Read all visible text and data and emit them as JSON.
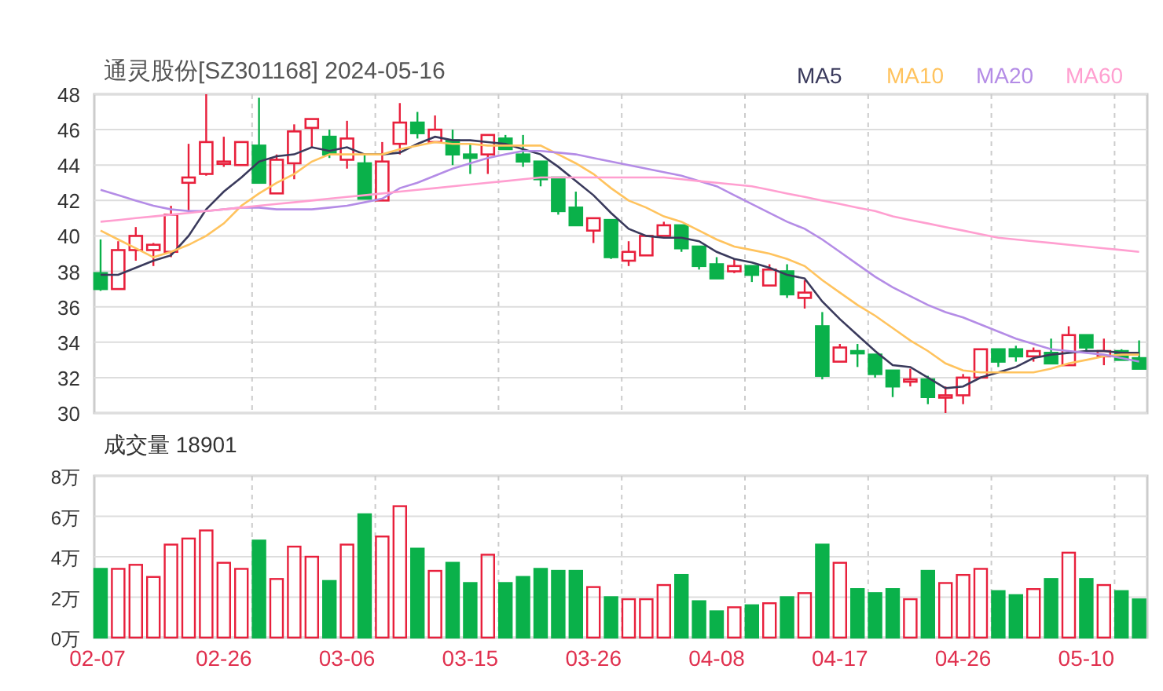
{
  "price_chart": {
    "chart_data": {
      "type": "candlestick",
      "title": "通灵股份[SZ301168] 2024-05-16",
      "ylim": [
        30,
        48
      ],
      "yticks": [
        30,
        32,
        34,
        36,
        38,
        40,
        42,
        44,
        46,
        48
      ],
      "grid": true,
      "categories": [
        null,
        null,
        null,
        null,
        null,
        null,
        null,
        null,
        null,
        null,
        null,
        null,
        null,
        null,
        null,
        null,
        null,
        null,
        null,
        null,
        null,
        null,
        null,
        null,
        null,
        null,
        null,
        null,
        null,
        null,
        null,
        null,
        null,
        null,
        null,
        null,
        null,
        null,
        null,
        null,
        null,
        null,
        null,
        null,
        null,
        null,
        null,
        null,
        null,
        null,
        null,
        null,
        null,
        null,
        null,
        null,
        null,
        null,
        null,
        null
      ],
      "ohlc": [
        [
          37.9,
          39.8,
          36.9,
          37.0
        ],
        [
          37.0,
          39.7,
          37.0,
          39.2
        ],
        [
          39.2,
          40.5,
          38.6,
          40.0
        ],
        [
          39.2,
          39.6,
          38.3,
          39.5
        ],
        [
          39.1,
          41.7,
          38.8,
          41.2
        ],
        [
          43.0,
          45.2,
          41.4,
          43.3
        ],
        [
          43.5,
          48.0,
          43.4,
          45.3
        ],
        [
          44.1,
          45.6,
          43.9,
          44.2
        ],
        [
          44.0,
          45.3,
          44.0,
          45.3
        ],
        [
          45.1,
          47.8,
          43.0,
          43.0
        ],
        [
          42.4,
          44.6,
          42.4,
          44.3
        ],
        [
          44.1,
          46.3,
          43.2,
          45.9
        ],
        [
          46.1,
          46.6,
          45.0,
          46.6
        ],
        [
          45.6,
          46.0,
          44.4,
          44.6
        ],
        [
          44.3,
          46.5,
          43.8,
          45.5
        ],
        [
          44.1,
          44.6,
          42.1,
          42.1
        ],
        [
          42.0,
          45.3,
          42.0,
          44.2
        ],
        [
          45.2,
          47.5,
          44.6,
          46.4
        ],
        [
          46.4,
          47.0,
          45.5,
          45.8
        ],
        [
          45.3,
          46.8,
          45.3,
          46.0
        ],
        [
          45.4,
          46.0,
          44.0,
          44.6
        ],
        [
          44.6,
          45.2,
          43.5,
          44.4
        ],
        [
          44.6,
          45.7,
          43.5,
          45.7
        ],
        [
          45.5,
          45.7,
          44.9,
          44.9
        ],
        [
          44.6,
          45.7,
          43.9,
          44.2
        ],
        [
          44.2,
          44.2,
          42.8,
          43.2
        ],
        [
          43.3,
          43.3,
          41.2,
          41.4
        ],
        [
          41.6,
          42.5,
          40.6,
          40.6
        ],
        [
          40.3,
          41.0,
          39.6,
          41.0
        ],
        [
          40.9,
          40.9,
          38.7,
          38.8
        ],
        [
          38.6,
          39.7,
          38.3,
          39.1
        ],
        [
          38.9,
          40.0,
          38.9,
          40.0
        ],
        [
          40.0,
          40.8,
          40.0,
          40.6
        ],
        [
          40.6,
          40.6,
          39.1,
          39.3
        ],
        [
          39.4,
          39.4,
          38.1,
          38.3
        ],
        [
          38.4,
          38.8,
          37.6,
          37.6
        ],
        [
          38.0,
          38.7,
          37.9,
          38.3
        ],
        [
          38.3,
          38.3,
          37.4,
          37.8
        ],
        [
          37.2,
          38.4,
          37.2,
          38.1
        ],
        [
          38.0,
          38.4,
          36.5,
          36.7
        ],
        [
          36.5,
          37.5,
          35.9,
          36.8
        ],
        [
          34.9,
          35.7,
          31.9,
          32.1
        ],
        [
          32.9,
          33.9,
          32.9,
          33.7
        ],
        [
          33.5,
          33.9,
          32.6,
          33.4
        ],
        [
          33.3,
          33.3,
          32.0,
          32.2
        ],
        [
          32.4,
          32.4,
          30.9,
          31.5
        ],
        [
          31.8,
          32.5,
          31.5,
          31.9
        ],
        [
          31.9,
          32.1,
          30.5,
          30.9
        ],
        [
          30.9,
          31.5,
          30.0,
          31.0
        ],
        [
          31.0,
          32.2,
          30.5,
          32.0
        ],
        [
          32.0,
          33.6,
          32.0,
          33.6
        ],
        [
          33.6,
          33.6,
          32.6,
          32.9
        ],
        [
          33.6,
          33.8,
          32.9,
          33.2
        ],
        [
          33.2,
          33.7,
          32.9,
          33.5
        ],
        [
          33.4,
          34.2,
          32.8,
          32.8
        ],
        [
          32.7,
          34.9,
          32.7,
          34.4
        ],
        [
          34.4,
          34.4,
          33.4,
          33.7
        ],
        [
          33.2,
          34.2,
          32.7,
          33.5
        ],
        [
          33.5,
          33.6,
          33.0,
          33.0
        ],
        [
          33.1,
          34.1,
          32.5,
          32.5
        ]
      ],
      "series": [
        {
          "name": "MA5",
          "type": "line",
          "color": "#3a3a5c",
          "values": [
            37.8,
            37.8,
            38.2,
            38.6,
            38.9,
            40.0,
            41.5,
            42.5,
            43.3,
            44.2,
            44.5,
            44.6,
            45.0,
            44.8,
            45.0,
            44.6,
            44.6,
            44.7,
            45.2,
            45.6,
            45.4,
            45.4,
            45.3,
            45.2,
            44.9,
            44.6,
            43.9,
            43.1,
            42.3,
            41.3,
            40.4,
            40.0,
            39.9,
            39.9,
            39.7,
            39.1,
            38.7,
            38.5,
            38.2,
            37.8,
            37.6,
            36.3,
            35.3,
            34.4,
            33.5,
            32.7,
            32.6,
            32.0,
            31.4,
            31.5,
            32.0,
            32.3,
            32.6,
            33.1,
            33.3,
            33.4,
            33.5,
            33.5,
            33.4,
            33.4
          ]
        },
        {
          "name": "MA10",
          "type": "line",
          "color": "#ffc35e",
          "values": [
            40.3,
            39.8,
            39.3,
            38.8,
            39.1,
            39.5,
            40.0,
            40.7,
            41.7,
            42.4,
            43.0,
            43.5,
            44.2,
            44.6,
            44.6,
            44.6,
            44.6,
            44.9,
            45.1,
            45.3,
            45.2,
            45.2,
            45.1,
            45.1,
            45.1,
            45.1,
            44.6,
            44.1,
            43.5,
            42.7,
            42.0,
            41.6,
            41.1,
            40.8,
            40.3,
            39.8,
            39.4,
            39.2,
            39.0,
            38.7,
            38.3,
            37.5,
            36.8,
            36.1,
            35.5,
            34.8,
            34.1,
            33.5,
            32.8,
            32.4,
            32.3,
            32.3,
            32.3,
            32.3,
            32.5,
            32.8,
            33.0,
            33.2,
            33.3,
            33.3
          ]
        },
        {
          "name": "MA20",
          "type": "line",
          "color": "#b48ce6",
          "values": [
            42.6,
            42.3,
            42.0,
            41.7,
            41.5,
            41.4,
            41.4,
            41.5,
            41.6,
            41.6,
            41.5,
            41.5,
            41.5,
            41.6,
            41.7,
            41.9,
            42.1,
            42.7,
            43.0,
            43.4,
            43.8,
            44.1,
            44.4,
            44.6,
            44.8,
            44.8,
            44.7,
            44.6,
            44.4,
            44.2,
            44.0,
            43.8,
            43.6,
            43.4,
            43.1,
            42.8,
            42.3,
            41.8,
            41.3,
            40.8,
            40.4,
            39.8,
            39.1,
            38.4,
            37.7,
            37.1,
            36.6,
            36.1,
            35.7,
            35.4,
            35.0,
            34.6,
            34.2,
            33.9,
            33.6,
            33.5,
            33.4,
            33.3,
            33.1,
            32.9
          ]
        },
        {
          "name": "MA60",
          "type": "line",
          "color": "#ff9fd0",
          "values": [
            40.8,
            40.9,
            41.0,
            41.1,
            41.2,
            41.3,
            41.4,
            41.5,
            41.6,
            41.7,
            41.8,
            41.9,
            42.0,
            42.1,
            42.2,
            42.3,
            42.4,
            42.5,
            42.6,
            42.7,
            42.8,
            42.9,
            43.0,
            43.1,
            43.2,
            43.3,
            43.3,
            43.3,
            43.3,
            43.3,
            43.3,
            43.3,
            43.3,
            43.2,
            43.1,
            43.0,
            42.9,
            42.8,
            42.6,
            42.4,
            42.2,
            42.0,
            41.8,
            41.6,
            41.4,
            41.1,
            40.9,
            40.7,
            40.5,
            40.3,
            40.1,
            39.9,
            39.8,
            39.7,
            39.6,
            39.5,
            39.4,
            39.3,
            39.2,
            39.1
          ]
        }
      ]
    }
  },
  "volume_chart": {
    "chart_data": {
      "type": "bar",
      "title": "成交量 18901",
      "ylim": [
        0,
        8
      ],
      "grid": true,
      "yticks": [
        {
          "value": 0,
          "label": "0万"
        },
        {
          "value": 2,
          "label": "2万"
        },
        {
          "value": 4,
          "label": "4万"
        },
        {
          "value": 6,
          "label": "6万"
        },
        {
          "value": 8,
          "label": "8万"
        }
      ],
      "categories": [
        "02-07",
        null,
        null,
        null,
        null,
        null,
        null,
        "02-26",
        null,
        null,
        null,
        null,
        null,
        null,
        "03-06",
        null,
        null,
        null,
        null,
        null,
        null,
        "03-15",
        null,
        null,
        null,
        null,
        null,
        null,
        "03-26",
        null,
        null,
        null,
        null,
        null,
        null,
        "04-08",
        null,
        null,
        null,
        null,
        null,
        null,
        "04-17",
        null,
        null,
        null,
        null,
        null,
        null,
        "04-26",
        null,
        null,
        null,
        null,
        null,
        null,
        "05-10",
        null,
        null,
        null
      ],
      "values": [
        3.4,
        3.4,
        3.6,
        3.0,
        4.6,
        4.9,
        5.3,
        3.7,
        3.4,
        4.8,
        2.9,
        4.5,
        4.0,
        2.8,
        4.6,
        6.1,
        5.0,
        6.5,
        4.4,
        3.3,
        3.7,
        2.7,
        4.1,
        2.7,
        3.0,
        3.4,
        3.3,
        3.3,
        2.5,
        2.0,
        1.9,
        1.9,
        2.6,
        3.1,
        1.8,
        1.3,
        1.5,
        1.6,
        1.7,
        2.0,
        2.2,
        4.6,
        3.7,
        2.4,
        2.2,
        2.4,
        1.9,
        3.3,
        2.7,
        3.1,
        3.4,
        2.3,
        2.1,
        2.4,
        2.9,
        4.2,
        2.9,
        2.6,
        2.3,
        1.89
      ]
    }
  }
}
